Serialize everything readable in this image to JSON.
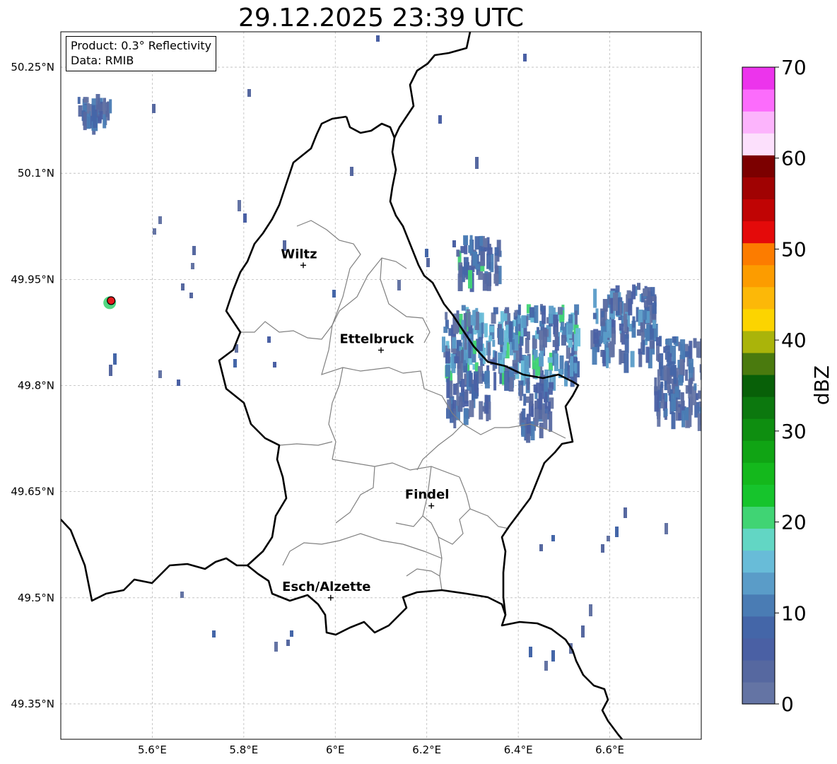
{
  "title": "29.12.2025 23:39 UTC",
  "info": {
    "product": "Product: 0.3° Reflectivity",
    "data": "Data: RMIB"
  },
  "map": {
    "extent": {
      "lon_min": 5.4,
      "lon_max": 6.8,
      "lat_min": 49.3,
      "lat_max": 50.3
    },
    "lat_ticks": [
      {
        "value": 50.25,
        "label": "50.25°N"
      },
      {
        "value": 50.1,
        "label": "50.1°N"
      },
      {
        "value": 49.95,
        "label": "49.95°N"
      },
      {
        "value": 49.8,
        "label": "49.8°N"
      },
      {
        "value": 49.65,
        "label": "49.65°N"
      },
      {
        "value": 49.5,
        "label": "49.5°N"
      },
      {
        "value": 49.35,
        "label": "49.35°N"
      }
    ],
    "lon_ticks": [
      {
        "value": 5.6,
        "label": "5.6°E"
      },
      {
        "value": 5.8,
        "label": "5.8°E"
      },
      {
        "value": 6.0,
        "label": "6°E"
      },
      {
        "value": 6.2,
        "label": "6.2°E"
      },
      {
        "value": 6.4,
        "label": "6.4°E"
      },
      {
        "value": 6.6,
        "label": "6.6°E"
      }
    ],
    "cities": [
      {
        "name": "Wiltz",
        "lon": 5.93,
        "lat": 49.97
      },
      {
        "name": "Ettelbruck",
        "lon": 6.1,
        "lat": 49.85
      },
      {
        "name": "Findel",
        "lon": 6.21,
        "lat": 49.63
      },
      {
        "name": "Esch/Alzette",
        "lon": 5.99,
        "lat": 49.5
      }
    ],
    "radar_site": {
      "lon": 5.51,
      "lat": 49.92,
      "color": "#e31a1c"
    },
    "border_color": "#000000",
    "district_color": "#808080",
    "grid_color": "#bbbbbb"
  },
  "colorbar": {
    "label": "dBZ",
    "ticks": [
      "0",
      "10",
      "20",
      "30",
      "40",
      "50",
      "60",
      "70"
    ],
    "min": 0,
    "max": 70,
    "colors": [
      "#6474a4",
      "#5668a0",
      "#4a60a4",
      "#4466a8",
      "#4a7cb4",
      "#5a9cc8",
      "#68bcd8",
      "#62d6c4",
      "#40d474",
      "#16c42c",
      "#14b81c",
      "#10a414",
      "#0e8e10",
      "#0c780e",
      "#086008",
      "#4a7a0e",
      "#aab40a",
      "#fcd400",
      "#fcb808",
      "#fc9c00",
      "#fc7c00",
      "#e40a0a",
      "#c00404",
      "#a00202",
      "#7c0000",
      "#fce0fc",
      "#fcb4fc",
      "#fc6cfc",
      "#ec34ec"
    ]
  }
}
